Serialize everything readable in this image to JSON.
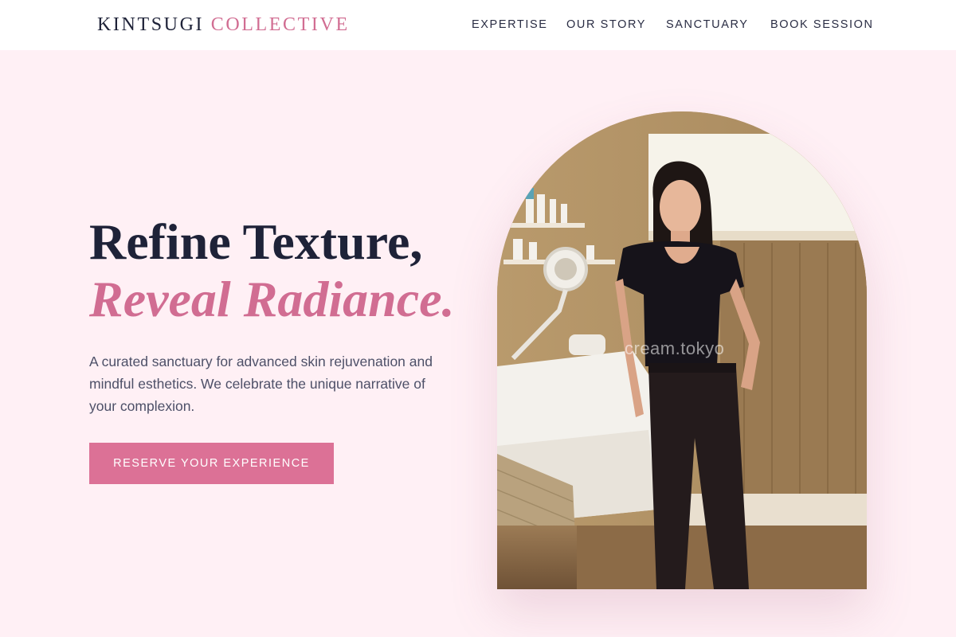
{
  "header": {
    "brand_primary": "KINTSUGI",
    "brand_accent": "COLLECTIVE",
    "nav": [
      {
        "label": "EXPERTISE"
      },
      {
        "label": "OUR STORY"
      },
      {
        "label": "SANCTUARY"
      },
      {
        "label": "BOOK SESSION"
      }
    ]
  },
  "hero": {
    "title_line1": "Refine Texture,",
    "title_line2": "Reveal Radiance.",
    "description": "A curated sanctuary for advanced skin rejuvenation and mindful esthetics. We celebrate the unique narrative of your complexion.",
    "cta_label": "RESERVE YOUR EXPERIENCE",
    "image_watermark": "cream.tokyo"
  },
  "colors": {
    "background": "#fff0f5",
    "accent": "#d16d92",
    "button": "#dc7196",
    "heading": "#1e2238",
    "body_text": "#4d5068"
  }
}
